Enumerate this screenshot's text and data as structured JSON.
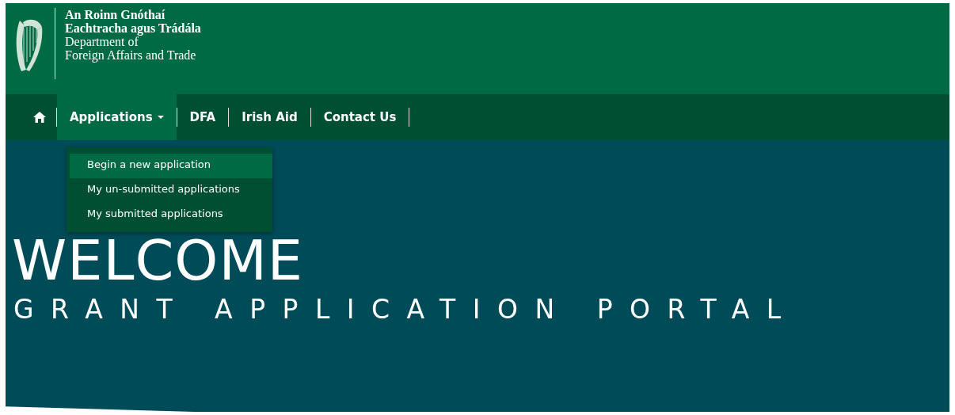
{
  "header": {
    "logo_lines": [
      {
        "text": "An Roinn Gnóthaí",
        "bold": true
      },
      {
        "text": "Eachtracha agus Trádála",
        "bold": true
      },
      {
        "text": "Department of",
        "bold": false
      },
      {
        "text": "Foreign Affairs and Trade",
        "bold": false
      }
    ]
  },
  "nav": {
    "items": [
      {
        "kind": "home",
        "selected": false
      },
      {
        "kind": "dropdown",
        "label": "Applications",
        "selected": true,
        "expanded": true
      },
      {
        "kind": "link",
        "label": "DFA",
        "selected": false
      },
      {
        "kind": "link",
        "label": "Irish Aid",
        "selected": false
      },
      {
        "kind": "link",
        "label": "Contact Us",
        "selected": false
      }
    ]
  },
  "dropdown": {
    "items": [
      {
        "label": "Begin a new application",
        "selected": true
      },
      {
        "label": "My un-submitted applications",
        "selected": false
      },
      {
        "label": "My submitted applications",
        "selected": false
      }
    ]
  },
  "hero": {
    "title": "WELCOME",
    "subtitle": "GRANT APPLICATION PORTAL"
  }
}
